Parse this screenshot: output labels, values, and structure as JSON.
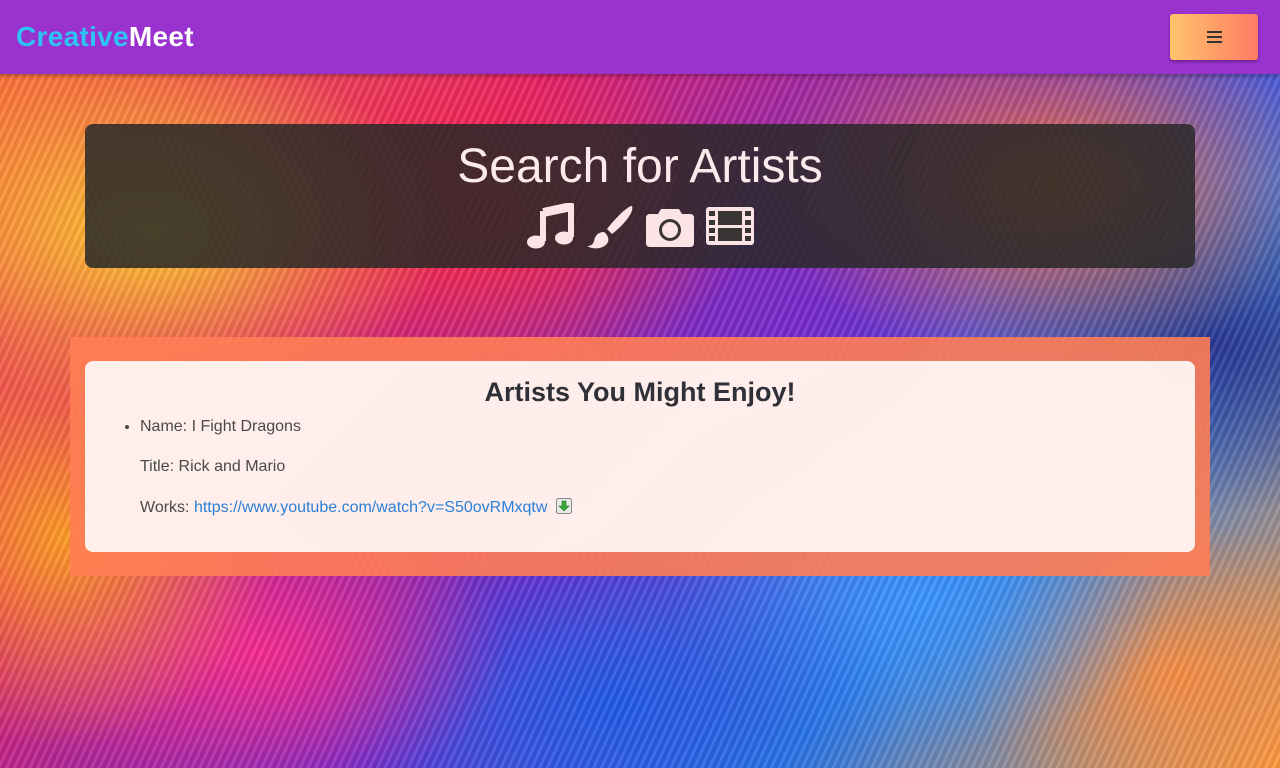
{
  "navbar": {
    "brand_part1": "Creative",
    "brand_part2": "Meet",
    "menu_icon": "hamburger-menu-icon",
    "brand_color": "#2ec3f5",
    "bar_color": "#9a32cf"
  },
  "hero": {
    "title": "Search for Artists",
    "icons": [
      "music-note-icon",
      "paintbrush-icon",
      "camera-icon",
      "film-icon"
    ]
  },
  "recommendations": {
    "title": "Artists You Might Enjoy!",
    "items": [
      {
        "name_label": "Name: I Fight Dragons",
        "title_label": "Title: Rick and Mario",
        "works_prefix": "Works:",
        "works_link": "https://www.youtube.com/watch?v=S50ovRMxqtw",
        "works_icon": "download-icon"
      }
    ]
  }
}
